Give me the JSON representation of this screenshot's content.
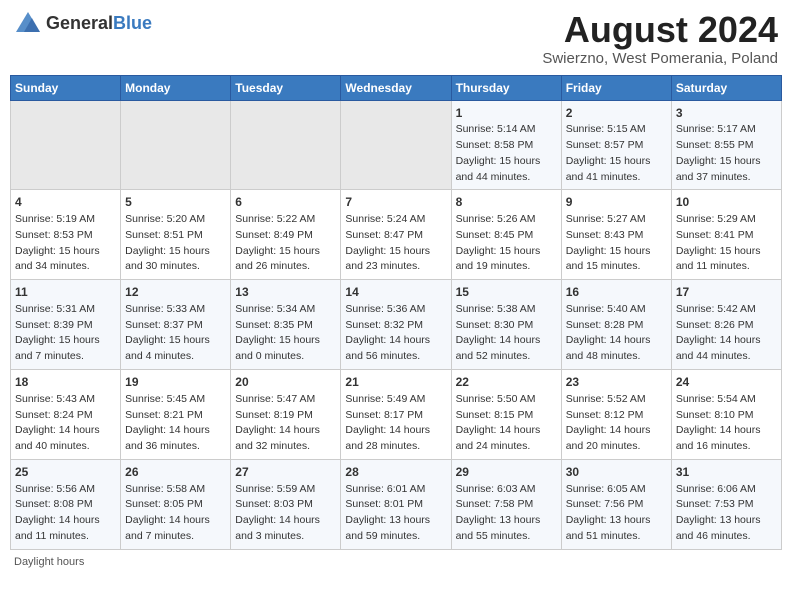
{
  "logo": {
    "general": "General",
    "blue": "Blue"
  },
  "header": {
    "month_year": "August 2024",
    "location": "Swierzno, West Pomerania, Poland"
  },
  "weekdays": [
    "Sunday",
    "Monday",
    "Tuesday",
    "Wednesday",
    "Thursday",
    "Friday",
    "Saturday"
  ],
  "weeks": [
    [
      {
        "day": "",
        "info": ""
      },
      {
        "day": "",
        "info": ""
      },
      {
        "day": "",
        "info": ""
      },
      {
        "day": "",
        "info": ""
      },
      {
        "day": "1",
        "info": "Sunrise: 5:14 AM\nSunset: 8:58 PM\nDaylight: 15 hours\nand 44 minutes."
      },
      {
        "day": "2",
        "info": "Sunrise: 5:15 AM\nSunset: 8:57 PM\nDaylight: 15 hours\nand 41 minutes."
      },
      {
        "day": "3",
        "info": "Sunrise: 5:17 AM\nSunset: 8:55 PM\nDaylight: 15 hours\nand 37 minutes."
      }
    ],
    [
      {
        "day": "4",
        "info": "Sunrise: 5:19 AM\nSunset: 8:53 PM\nDaylight: 15 hours\nand 34 minutes."
      },
      {
        "day": "5",
        "info": "Sunrise: 5:20 AM\nSunset: 8:51 PM\nDaylight: 15 hours\nand 30 minutes."
      },
      {
        "day": "6",
        "info": "Sunrise: 5:22 AM\nSunset: 8:49 PM\nDaylight: 15 hours\nand 26 minutes."
      },
      {
        "day": "7",
        "info": "Sunrise: 5:24 AM\nSunset: 8:47 PM\nDaylight: 15 hours\nand 23 minutes."
      },
      {
        "day": "8",
        "info": "Sunrise: 5:26 AM\nSunset: 8:45 PM\nDaylight: 15 hours\nand 19 minutes."
      },
      {
        "day": "9",
        "info": "Sunrise: 5:27 AM\nSunset: 8:43 PM\nDaylight: 15 hours\nand 15 minutes."
      },
      {
        "day": "10",
        "info": "Sunrise: 5:29 AM\nSunset: 8:41 PM\nDaylight: 15 hours\nand 11 minutes."
      }
    ],
    [
      {
        "day": "11",
        "info": "Sunrise: 5:31 AM\nSunset: 8:39 PM\nDaylight: 15 hours\nand 7 minutes."
      },
      {
        "day": "12",
        "info": "Sunrise: 5:33 AM\nSunset: 8:37 PM\nDaylight: 15 hours\nand 4 minutes."
      },
      {
        "day": "13",
        "info": "Sunrise: 5:34 AM\nSunset: 8:35 PM\nDaylight: 15 hours\nand 0 minutes."
      },
      {
        "day": "14",
        "info": "Sunrise: 5:36 AM\nSunset: 8:32 PM\nDaylight: 14 hours\nand 56 minutes."
      },
      {
        "day": "15",
        "info": "Sunrise: 5:38 AM\nSunset: 8:30 PM\nDaylight: 14 hours\nand 52 minutes."
      },
      {
        "day": "16",
        "info": "Sunrise: 5:40 AM\nSunset: 8:28 PM\nDaylight: 14 hours\nand 48 minutes."
      },
      {
        "day": "17",
        "info": "Sunrise: 5:42 AM\nSunset: 8:26 PM\nDaylight: 14 hours\nand 44 minutes."
      }
    ],
    [
      {
        "day": "18",
        "info": "Sunrise: 5:43 AM\nSunset: 8:24 PM\nDaylight: 14 hours\nand 40 minutes."
      },
      {
        "day": "19",
        "info": "Sunrise: 5:45 AM\nSunset: 8:21 PM\nDaylight: 14 hours\nand 36 minutes."
      },
      {
        "day": "20",
        "info": "Sunrise: 5:47 AM\nSunset: 8:19 PM\nDaylight: 14 hours\nand 32 minutes."
      },
      {
        "day": "21",
        "info": "Sunrise: 5:49 AM\nSunset: 8:17 PM\nDaylight: 14 hours\nand 28 minutes."
      },
      {
        "day": "22",
        "info": "Sunrise: 5:50 AM\nSunset: 8:15 PM\nDaylight: 14 hours\nand 24 minutes."
      },
      {
        "day": "23",
        "info": "Sunrise: 5:52 AM\nSunset: 8:12 PM\nDaylight: 14 hours\nand 20 minutes."
      },
      {
        "day": "24",
        "info": "Sunrise: 5:54 AM\nSunset: 8:10 PM\nDaylight: 14 hours\nand 16 minutes."
      }
    ],
    [
      {
        "day": "25",
        "info": "Sunrise: 5:56 AM\nSunset: 8:08 PM\nDaylight: 14 hours\nand 11 minutes."
      },
      {
        "day": "26",
        "info": "Sunrise: 5:58 AM\nSunset: 8:05 PM\nDaylight: 14 hours\nand 7 minutes."
      },
      {
        "day": "27",
        "info": "Sunrise: 5:59 AM\nSunset: 8:03 PM\nDaylight: 14 hours\nand 3 minutes."
      },
      {
        "day": "28",
        "info": "Sunrise: 6:01 AM\nSunset: 8:01 PM\nDaylight: 13 hours\nand 59 minutes."
      },
      {
        "day": "29",
        "info": "Sunrise: 6:03 AM\nSunset: 7:58 PM\nDaylight: 13 hours\nand 55 minutes."
      },
      {
        "day": "30",
        "info": "Sunrise: 6:05 AM\nSunset: 7:56 PM\nDaylight: 13 hours\nand 51 minutes."
      },
      {
        "day": "31",
        "info": "Sunrise: 6:06 AM\nSunset: 7:53 PM\nDaylight: 13 hours\nand 46 minutes."
      }
    ]
  ],
  "footer": {
    "daylight_label": "Daylight hours"
  }
}
